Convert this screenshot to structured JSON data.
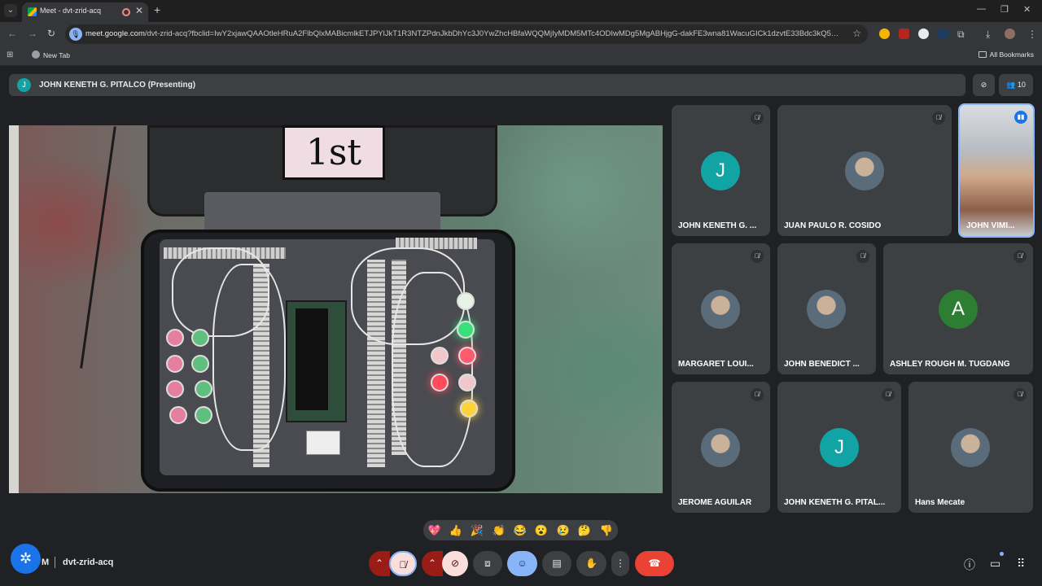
{
  "browser": {
    "tab_title": "Meet - dvt-zrid-acq",
    "url_host": "meet.google.com",
    "url_rest": "/dvt-zrid-acq?fbclid=IwY2xjawQAAOtleHRuA2FlbQlxMABicmlkETJPYlJkT1R3NTZPdnJkbDhYc3J0YwZhcHBfaWQQMjIyMDM5MTc4ODIwMDg5MgABHjgG-dakFE3wna81WacuGICk1dzvtE33Bdc3kQ5Kk4KYTHJBgl...",
    "bookmark_new_tab": "New Tab",
    "all_bookmarks": "All Bookmarks",
    "icons": {
      "tab_search": "chevron-down-icon",
      "recording": "record-icon",
      "star": "star-icon",
      "download": "download-icon",
      "extensions": "puzzle-icon",
      "menu": "kebab-icon"
    }
  },
  "meet": {
    "presenter_initial": "J",
    "presenter_label": "JOHN KENETH G. PITALCO (Presenting)",
    "participant_count": "10",
    "presentation_sign": "1st",
    "tiles": [
      {
        "name": "JOHN KENETH G. ...",
        "kind": "letter",
        "letter": "J",
        "color": "#12a4a4"
      },
      {
        "name": "JUAN PAULO R. COSIDO",
        "kind": "photo"
      },
      {
        "name": "JOHN VIMI...",
        "kind": "video"
      },
      {
        "name": "MARGARET LOUI...",
        "kind": "photo"
      },
      {
        "name": "JOHN BENEDICT ...",
        "kind": "photo"
      },
      {
        "name": "ASHLEY ROUGH M. TUGDANG",
        "kind": "letter",
        "letter": "A",
        "color": "#2d7d32"
      },
      {
        "name": "JEROME AGUILAR",
        "kind": "photo"
      },
      {
        "name": "JOHN KENETH G. PITAL...",
        "kind": "letter",
        "letter": "J",
        "color": "#12a4a4"
      },
      {
        "name": "Hans Mecate",
        "kind": "photo"
      }
    ],
    "reactions": [
      "💖",
      "👍",
      "🎉",
      "👏",
      "😂",
      "😮",
      "😢",
      "🤔",
      "👎"
    ],
    "clock_fragment": "M",
    "meeting_code": "dvt-zrid-acq",
    "colors": {
      "accent": "#1a73e8",
      "end_call": "#ea4335",
      "muted_bg": "#f9dedc",
      "active_blue": "#8ab4f8"
    }
  }
}
